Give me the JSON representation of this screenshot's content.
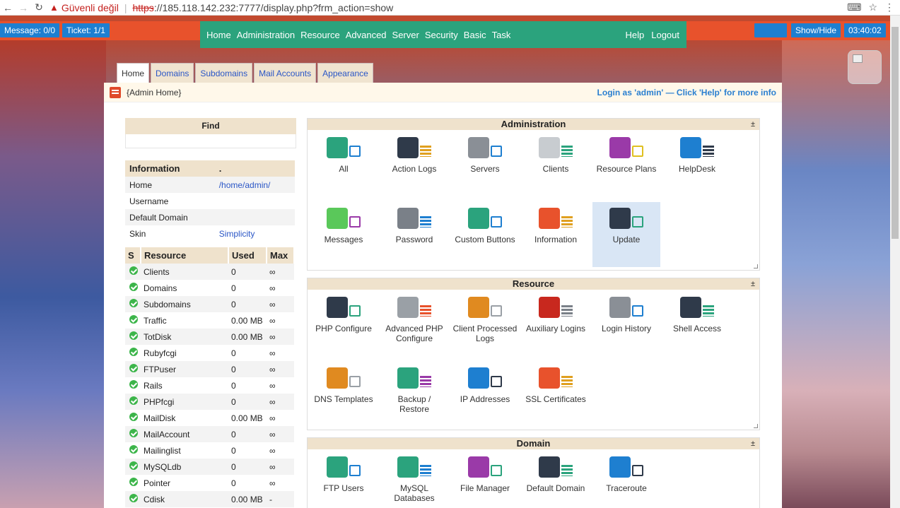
{
  "browser": {
    "security_label": "Güvenli değil",
    "url_scheme": "https",
    "url_rest": "://185.118.142.232:7777/display.php?frm_action=show"
  },
  "appbar": {
    "message": "Message: 0/0",
    "ticket": "Ticket: 1/1",
    "menu": [
      "Home",
      "Administration",
      "Resource",
      "Advanced",
      "Server",
      "Security",
      "Basic",
      "Task"
    ],
    "help": "Help",
    "logout": "Logout",
    "show_hide": "Show/Hide",
    "clock": "03:40:02"
  },
  "tabs": [
    "Home",
    "Domains",
    "Subdomains",
    "Mail Accounts",
    "Appearance"
  ],
  "panel": {
    "title": "{Admin Home}",
    "login_note": "Login as 'admin' — Click 'Help' for more info"
  },
  "find": {
    "title": "Find"
  },
  "info": {
    "headers": [
      "Information",
      "."
    ],
    "rows": [
      {
        "label": "Home",
        "value": "/home/admin/"
      },
      {
        "label": "Username",
        "value": ""
      },
      {
        "label": "Default Domain",
        "value": ""
      },
      {
        "label": "Skin",
        "value": "Simplicity"
      }
    ]
  },
  "resources": {
    "headers": [
      "S",
      "Resource",
      "Used",
      "Max"
    ],
    "rows": [
      {
        "name": "Clients",
        "used": "0",
        "max": "∞"
      },
      {
        "name": "Domains",
        "used": "0",
        "max": "∞"
      },
      {
        "name": "Subdomains",
        "used": "0",
        "max": "∞"
      },
      {
        "name": "Traffic",
        "used": "0.00 MB",
        "max": "∞"
      },
      {
        "name": "TotDisk",
        "used": "0.00 MB",
        "max": "∞"
      },
      {
        "name": "Rubyfcgi",
        "used": "0",
        "max": "∞"
      },
      {
        "name": "FTPuser",
        "used": "0",
        "max": "∞"
      },
      {
        "name": "Rails",
        "used": "0",
        "max": "∞"
      },
      {
        "name": "PHPfcgi",
        "used": "0",
        "max": "∞"
      },
      {
        "name": "MailDisk",
        "used": "0.00 MB",
        "max": "∞"
      },
      {
        "name": "MailAccount",
        "used": "0",
        "max": "∞"
      },
      {
        "name": "Mailinglist",
        "used": "0",
        "max": "∞"
      },
      {
        "name": "MySQLdb",
        "used": "0",
        "max": "∞"
      },
      {
        "name": "Pointer",
        "used": "0",
        "max": "∞"
      },
      {
        "name": "Cdisk",
        "used": "0.00 MB",
        "max": "-"
      }
    ]
  },
  "sections": [
    {
      "title": "Administration",
      "toggle": "±",
      "items": [
        {
          "label": "All",
          "icon": "users-icon",
          "color": "#2ba37d",
          "sub": "#1e7fd0"
        },
        {
          "label": "Action Logs",
          "icon": "action-logs-icon",
          "color": "#2f3a4a",
          "sub": "#e0a020"
        },
        {
          "label": "Servers",
          "icon": "servers-icon",
          "color": "#8a8f96",
          "sub": "#1e7fd0"
        },
        {
          "label": "Clients",
          "icon": "clients-icon",
          "color": "#c8ccd0",
          "sub": "#2ba37d"
        },
        {
          "label": "Resource Plans",
          "icon": "resource-plans-icon",
          "color": "#9a3aa8",
          "sub": "#e0c020"
        },
        {
          "label": "HelpDesk",
          "icon": "helpdesk-icon",
          "color": "#1e7fd0",
          "sub": "#2f3a4a"
        },
        {
          "label": "Messages",
          "icon": "messages-icon",
          "color": "#5ac85a",
          "sub": "#9a3aa8"
        },
        {
          "label": "Password",
          "icon": "password-icon",
          "color": "#7a8088",
          "sub": "#1e7fd0"
        },
        {
          "label": "Custom Buttons",
          "icon": "custom-buttons-icon",
          "color": "#2ba37d",
          "sub": "#1e7fd0"
        },
        {
          "label": "Information",
          "icon": "information-icon",
          "color": "#e8522c",
          "sub": "#e0a020"
        },
        {
          "label": "Update",
          "icon": "update-icon",
          "color": "#2f3a4a",
          "sub": "#2ba37d",
          "highlight": true
        }
      ]
    },
    {
      "title": "Resource",
      "toggle": "±",
      "items": [
        {
          "label": "PHP Configure",
          "icon": "php-icon",
          "color": "#2f3a4a",
          "sub": "#2ba37d"
        },
        {
          "label": "Advanced PHP Configure",
          "icon": "advanced-php-icon",
          "color": "#9aa0a6",
          "sub": "#e8522c"
        },
        {
          "label": "Client Processed Logs",
          "icon": "client-logs-icon",
          "color": "#e08a20",
          "sub": "#9aa0a6"
        },
        {
          "label": "Auxiliary Logins",
          "icon": "auxiliary-logins-icon",
          "color": "#c8281e",
          "sub": "#7a8088"
        },
        {
          "label": "Login History",
          "icon": "login-history-icon",
          "color": "#8a8f96",
          "sub": "#1e7fd0"
        },
        {
          "label": "Shell Access",
          "icon": "shell-access-icon",
          "color": "#2f3a4a",
          "sub": "#2ba37d"
        },
        {
          "label": "DNS Templates",
          "icon": "dns-templates-icon",
          "color": "#e08a20",
          "sub": "#9aa0a6"
        },
        {
          "label": "Backup / Restore",
          "icon": "backup-restore-icon",
          "color": "#2ba37d",
          "sub": "#9a3aa8"
        },
        {
          "label": "IP Addresses",
          "icon": "ip-addresses-icon",
          "color": "#1e7fd0",
          "sub": "#2f3a4a"
        },
        {
          "label": "SSL Certificates",
          "icon": "ssl-certificates-icon",
          "color": "#e8522c",
          "sub": "#e0a020"
        }
      ]
    },
    {
      "title": "Domain",
      "toggle": "±",
      "items": [
        {
          "label": "FTP Users",
          "icon": "ftp-users-icon",
          "color": "#2ba37d",
          "sub": "#1e7fd0"
        },
        {
          "label": "MySQL Databases",
          "icon": "mysql-icon",
          "color": "#2ba37d",
          "sub": "#1e7fd0"
        },
        {
          "label": "File Manager",
          "icon": "file-manager-icon",
          "color": "#9a3aa8",
          "sub": "#2ba37d"
        },
        {
          "label": "Default Domain",
          "icon": "default-domain-icon",
          "color": "#2f3a4a",
          "sub": "#2ba37d"
        },
        {
          "label": "Traceroute",
          "icon": "traceroute-icon",
          "color": "#1e7fd0",
          "sub": "#2f3a4a"
        }
      ]
    }
  ]
}
